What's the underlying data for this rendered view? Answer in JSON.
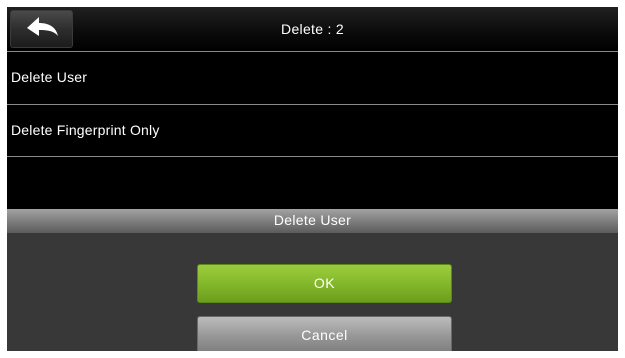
{
  "header": {
    "title": "Delete : 2",
    "back_icon": "back-arrow-icon"
  },
  "menu": {
    "items": [
      {
        "label": "Delete User"
      },
      {
        "label": "Delete Fingerprint Only"
      },
      {
        "label": ""
      }
    ]
  },
  "dialog": {
    "title": "Delete User",
    "ok_label": "OK",
    "cancel_label": "Cancel"
  },
  "colors": {
    "ok_button": "#84b82b",
    "cancel_button": "#989898",
    "background": "#000000"
  }
}
